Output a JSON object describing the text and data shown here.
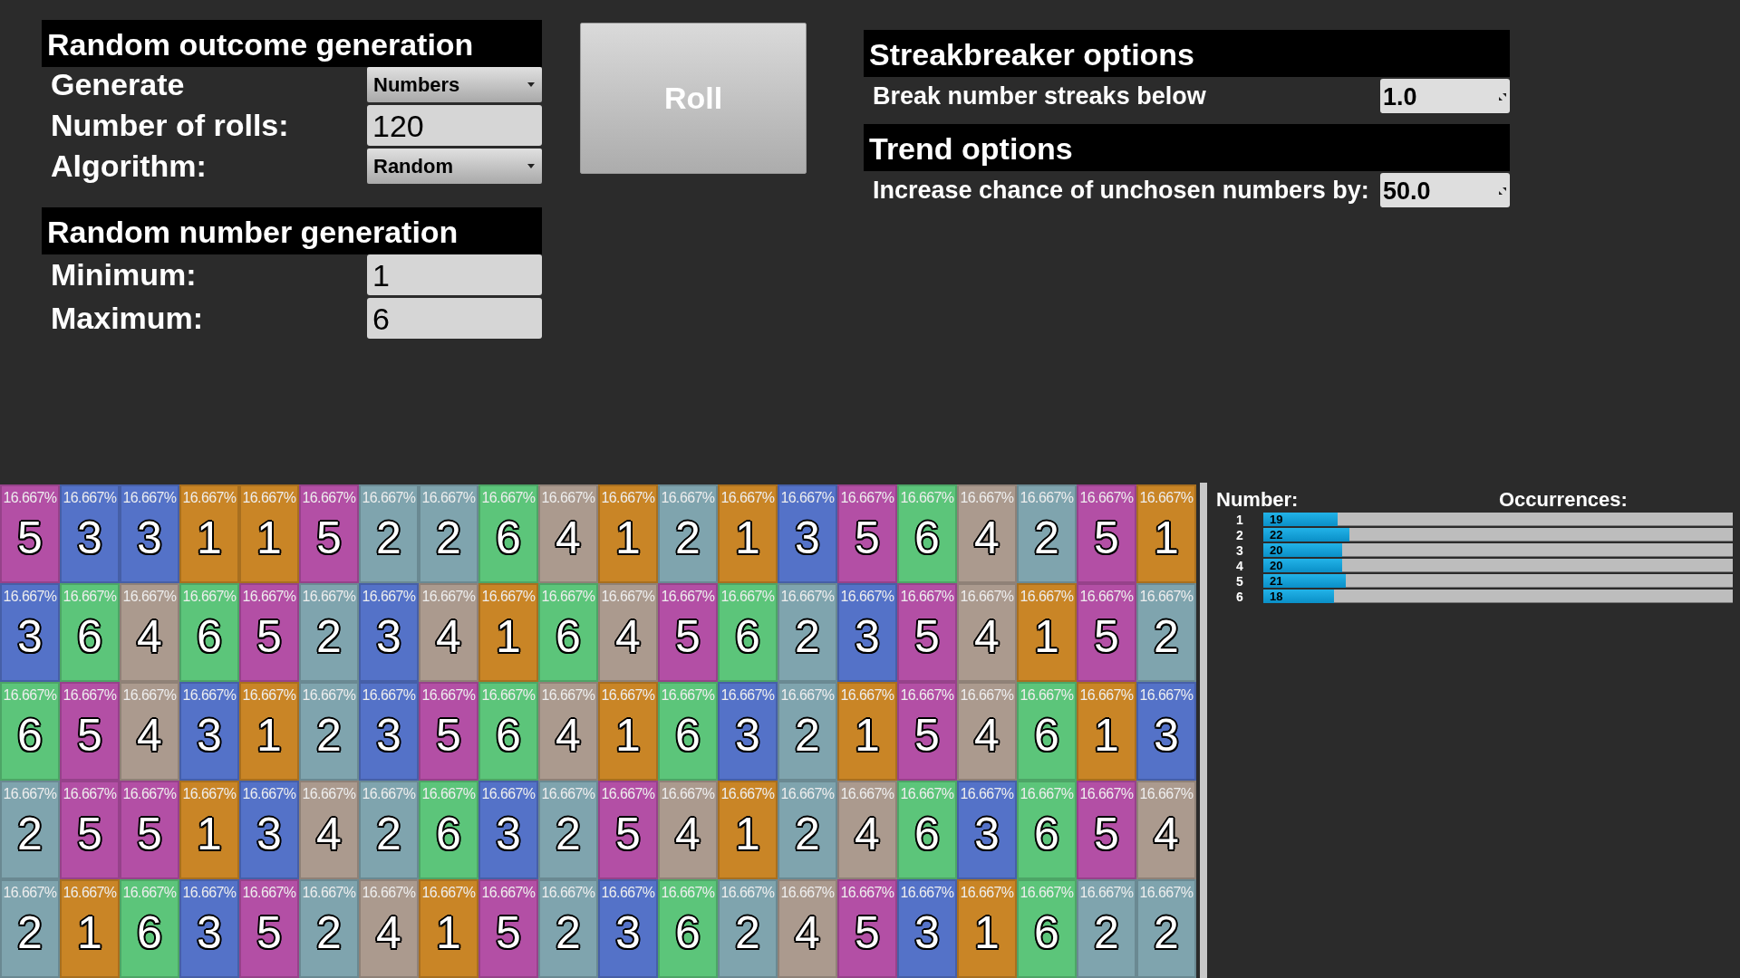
{
  "outcome_panel": {
    "title": "Random outcome generation",
    "fields": [
      {
        "kind": "dropdown",
        "label": "Generate",
        "value": "Numbers"
      },
      {
        "kind": "text",
        "label": "Number of rolls:",
        "value": "120"
      },
      {
        "kind": "dropdown",
        "label": "Algorithm:",
        "value": "Random"
      }
    ]
  },
  "number_panel": {
    "title": "Random number generation",
    "fields": [
      {
        "kind": "text",
        "label": "Minimum:",
        "value": "1"
      },
      {
        "kind": "text",
        "label": "Maximum:",
        "value": "6"
      }
    ]
  },
  "roll_button": "Roll",
  "streakbreaker_panel": {
    "title": "Streakbreaker options",
    "fields": [
      {
        "kind": "spinner",
        "label": "Break number streaks below",
        "value": "1.0"
      }
    ]
  },
  "trend_panel": {
    "title": "Trend options",
    "fields": [
      {
        "kind": "spinner",
        "label": "Increase chance of unchosen numbers by:",
        "value": "50.0"
      }
    ]
  },
  "tiles": [
    {
      "percent": "16.667%",
      "number": "5",
      "color": "#b34fa5"
    },
    {
      "percent": "16.667%",
      "number": "3",
      "color": "#5472c8"
    },
    {
      "percent": "16.667%",
      "number": "3",
      "color": "#5472c8"
    },
    {
      "percent": "16.667%",
      "number": "1",
      "color": "#c98526"
    },
    {
      "percent": "16.667%",
      "number": "1",
      "color": "#c98526"
    },
    {
      "percent": "16.667%",
      "number": "5",
      "color": "#b34fa5"
    },
    {
      "percent": "16.667%",
      "number": "2",
      "color": "#7fa4ae"
    },
    {
      "percent": "16.667%",
      "number": "2",
      "color": "#7fa4ae"
    },
    {
      "percent": "16.667%",
      "number": "6",
      "color": "#5cc57a"
    },
    {
      "percent": "16.667%",
      "number": "4",
      "color": "#ab9a8e"
    },
    {
      "percent": "16.667%",
      "number": "1",
      "color": "#c98526"
    },
    {
      "percent": "16.667%",
      "number": "2",
      "color": "#7fa4ae"
    },
    {
      "percent": "16.667%",
      "number": "1",
      "color": "#c98526"
    },
    {
      "percent": "16.667%",
      "number": "3",
      "color": "#5472c8"
    },
    {
      "percent": "16.667%",
      "number": "5",
      "color": "#b34fa5"
    },
    {
      "percent": "16.667%",
      "number": "6",
      "color": "#5cc57a"
    },
    {
      "percent": "16.667%",
      "number": "4",
      "color": "#ab9a8e"
    },
    {
      "percent": "16.667%",
      "number": "2",
      "color": "#7fa4ae"
    },
    {
      "percent": "16.667%",
      "number": "5",
      "color": "#b34fa5"
    },
    {
      "percent": "16.667%",
      "number": "1",
      "color": "#c98526"
    },
    {
      "percent": "16.667%",
      "number": "3",
      "color": "#5472c8"
    },
    {
      "percent": "16.667%",
      "number": "6",
      "color": "#5cc57a"
    },
    {
      "percent": "16.667%",
      "number": "4",
      "color": "#ab9a8e"
    },
    {
      "percent": "16.667%",
      "number": "6",
      "color": "#5cc57a"
    },
    {
      "percent": "16.667%",
      "number": "5",
      "color": "#b34fa5"
    },
    {
      "percent": "16.667%",
      "number": "2",
      "color": "#7fa4ae"
    },
    {
      "percent": "16.667%",
      "number": "3",
      "color": "#5472c8"
    },
    {
      "percent": "16.667%",
      "number": "4",
      "color": "#ab9a8e"
    },
    {
      "percent": "16.667%",
      "number": "1",
      "color": "#c98526"
    },
    {
      "percent": "16.667%",
      "number": "6",
      "color": "#5cc57a"
    },
    {
      "percent": "16.667%",
      "number": "4",
      "color": "#ab9a8e"
    },
    {
      "percent": "16.667%",
      "number": "5",
      "color": "#b34fa5"
    },
    {
      "percent": "16.667%",
      "number": "6",
      "color": "#5cc57a"
    },
    {
      "percent": "16.667%",
      "number": "2",
      "color": "#7fa4ae"
    },
    {
      "percent": "16.667%",
      "number": "3",
      "color": "#5472c8"
    },
    {
      "percent": "16.667%",
      "number": "5",
      "color": "#b34fa5"
    },
    {
      "percent": "16.667%",
      "number": "4",
      "color": "#ab9a8e"
    },
    {
      "percent": "16.667%",
      "number": "1",
      "color": "#c98526"
    },
    {
      "percent": "16.667%",
      "number": "5",
      "color": "#b34fa5"
    },
    {
      "percent": "16.667%",
      "number": "2",
      "color": "#7fa4ae"
    },
    {
      "percent": "16.667%",
      "number": "6",
      "color": "#5cc57a"
    },
    {
      "percent": "16.667%",
      "number": "5",
      "color": "#b34fa5"
    },
    {
      "percent": "16.667%",
      "number": "4",
      "color": "#ab9a8e"
    },
    {
      "percent": "16.667%",
      "number": "3",
      "color": "#5472c8"
    },
    {
      "percent": "16.667%",
      "number": "1",
      "color": "#c98526"
    },
    {
      "percent": "16.667%",
      "number": "2",
      "color": "#7fa4ae"
    },
    {
      "percent": "16.667%",
      "number": "3",
      "color": "#5472c8"
    },
    {
      "percent": "16.667%",
      "number": "5",
      "color": "#b34fa5"
    },
    {
      "percent": "16.667%",
      "number": "6",
      "color": "#5cc57a"
    },
    {
      "percent": "16.667%",
      "number": "4",
      "color": "#ab9a8e"
    },
    {
      "percent": "16.667%",
      "number": "1",
      "color": "#c98526"
    },
    {
      "percent": "16.667%",
      "number": "6",
      "color": "#5cc57a"
    },
    {
      "percent": "16.667%",
      "number": "3",
      "color": "#5472c8"
    },
    {
      "percent": "16.667%",
      "number": "2",
      "color": "#7fa4ae"
    },
    {
      "percent": "16.667%",
      "number": "1",
      "color": "#c98526"
    },
    {
      "percent": "16.667%",
      "number": "5",
      "color": "#b34fa5"
    },
    {
      "percent": "16.667%",
      "number": "4",
      "color": "#ab9a8e"
    },
    {
      "percent": "16.667%",
      "number": "6",
      "color": "#5cc57a"
    },
    {
      "percent": "16.667%",
      "number": "1",
      "color": "#c98526"
    },
    {
      "percent": "16.667%",
      "number": "3",
      "color": "#5472c8"
    },
    {
      "percent": "16.667%",
      "number": "2",
      "color": "#7fa4ae"
    },
    {
      "percent": "16.667%",
      "number": "5",
      "color": "#b34fa5"
    },
    {
      "percent": "16.667%",
      "number": "5",
      "color": "#b34fa5"
    },
    {
      "percent": "16.667%",
      "number": "1",
      "color": "#c98526"
    },
    {
      "percent": "16.667%",
      "number": "3",
      "color": "#5472c8"
    },
    {
      "percent": "16.667%",
      "number": "4",
      "color": "#ab9a8e"
    },
    {
      "percent": "16.667%",
      "number": "2",
      "color": "#7fa4ae"
    },
    {
      "percent": "16.667%",
      "number": "6",
      "color": "#5cc57a"
    },
    {
      "percent": "16.667%",
      "number": "3",
      "color": "#5472c8"
    },
    {
      "percent": "16.667%",
      "number": "2",
      "color": "#7fa4ae"
    },
    {
      "percent": "16.667%",
      "number": "5",
      "color": "#b34fa5"
    },
    {
      "percent": "16.667%",
      "number": "4",
      "color": "#ab9a8e"
    },
    {
      "percent": "16.667%",
      "number": "1",
      "color": "#c98526"
    },
    {
      "percent": "16.667%",
      "number": "2",
      "color": "#7fa4ae"
    },
    {
      "percent": "16.667%",
      "number": "4",
      "color": "#ab9a8e"
    },
    {
      "percent": "16.667%",
      "number": "6",
      "color": "#5cc57a"
    },
    {
      "percent": "16.667%",
      "number": "3",
      "color": "#5472c8"
    },
    {
      "percent": "16.667%",
      "number": "6",
      "color": "#5cc57a"
    },
    {
      "percent": "16.667%",
      "number": "5",
      "color": "#b34fa5"
    },
    {
      "percent": "16.667%",
      "number": "4",
      "color": "#ab9a8e"
    },
    {
      "percent": "16.667%",
      "number": "2",
      "color": "#7fa4ae"
    },
    {
      "percent": "16.667%",
      "number": "1",
      "color": "#c98526"
    },
    {
      "percent": "16.667%",
      "number": "6",
      "color": "#5cc57a"
    },
    {
      "percent": "16.667%",
      "number": "3",
      "color": "#5472c8"
    },
    {
      "percent": "16.667%",
      "number": "5",
      "color": "#b34fa5"
    },
    {
      "percent": "16.667%",
      "number": "2",
      "color": "#7fa4ae"
    },
    {
      "percent": "16.667%",
      "number": "4",
      "color": "#ab9a8e"
    },
    {
      "percent": "16.667%",
      "number": "1",
      "color": "#c98526"
    },
    {
      "percent": "16.667%",
      "number": "5",
      "color": "#b34fa5"
    },
    {
      "percent": "16.667%",
      "number": "2",
      "color": "#7fa4ae"
    },
    {
      "percent": "16.667%",
      "number": "3",
      "color": "#5472c8"
    },
    {
      "percent": "16.667%",
      "number": "6",
      "color": "#5cc57a"
    },
    {
      "percent": "16.667%",
      "number": "2",
      "color": "#7fa4ae"
    },
    {
      "percent": "16.667%",
      "number": "4",
      "color": "#ab9a8e"
    },
    {
      "percent": "16.667%",
      "number": "5",
      "color": "#b34fa5"
    },
    {
      "percent": "16.667%",
      "number": "3",
      "color": "#5472c8"
    },
    {
      "percent": "16.667%",
      "number": "1",
      "color": "#c98526"
    },
    {
      "percent": "16.667%",
      "number": "6",
      "color": "#5cc57a"
    },
    {
      "percent": "16.667%",
      "number": "2",
      "color": "#7fa4ae"
    },
    {
      "percent": "16.667%",
      "number": "2",
      "color": "#7fa4ae"
    }
  ],
  "histogram": {
    "number_header": "Number:",
    "occurrences_header": "Occurrences:",
    "rows": [
      {
        "number": "1",
        "count": "19",
        "level": 0.158
      },
      {
        "number": "2",
        "count": "22",
        "level": 0.183
      },
      {
        "number": "3",
        "count": "20",
        "level": 0.167
      },
      {
        "number": "4",
        "count": "20",
        "level": 0.167
      },
      {
        "number": "5",
        "count": "21",
        "level": 0.175
      },
      {
        "number": "6",
        "count": "18",
        "level": 0.15
      }
    ]
  }
}
